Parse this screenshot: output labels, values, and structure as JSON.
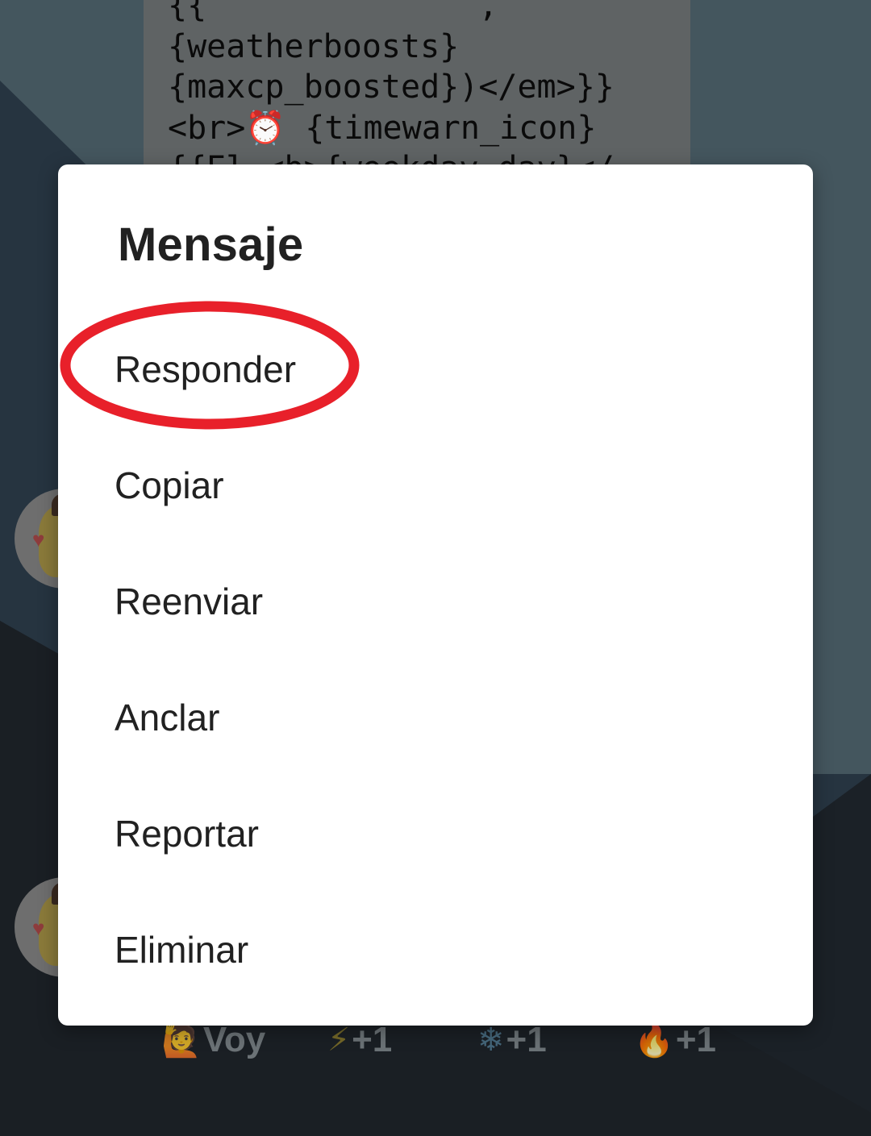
{
  "background_message": {
    "lines": [
      "{weatherboosts}",
      "{maxcp_boosted})</em>}}",
      "<br>⏰ {timewarn_icon}",
      "{{El <b>{weekday_day}</"
    ]
  },
  "reactions": [
    {
      "emoji": "🙋",
      "label": "Voy"
    },
    {
      "emoji": "⚡",
      "label": "+1"
    },
    {
      "emoji": "❄",
      "label": "+1"
    },
    {
      "emoji": "🔥",
      "label": "+1"
    }
  ],
  "dialog": {
    "title": "Mensaje",
    "items": [
      {
        "label": "Responder",
        "highlighted": true
      },
      {
        "label": "Copiar"
      },
      {
        "label": "Reenviar"
      },
      {
        "label": "Anclar"
      },
      {
        "label": "Reportar"
      },
      {
        "label": "Eliminar"
      }
    ]
  },
  "colors": {
    "scrim_wallpaper_light": "#44565e",
    "scrim_wallpaper_mid": "#283642",
    "scrim_wallpaper_dark": "#1a1f24",
    "dialog_bg": "#ffffff",
    "text_primary": "#212121",
    "highlight_ring": "#e8202a"
  },
  "icons": {
    "alarm_clock": "alarm-clock-icon",
    "highlight": "red-ellipse-annotation"
  }
}
